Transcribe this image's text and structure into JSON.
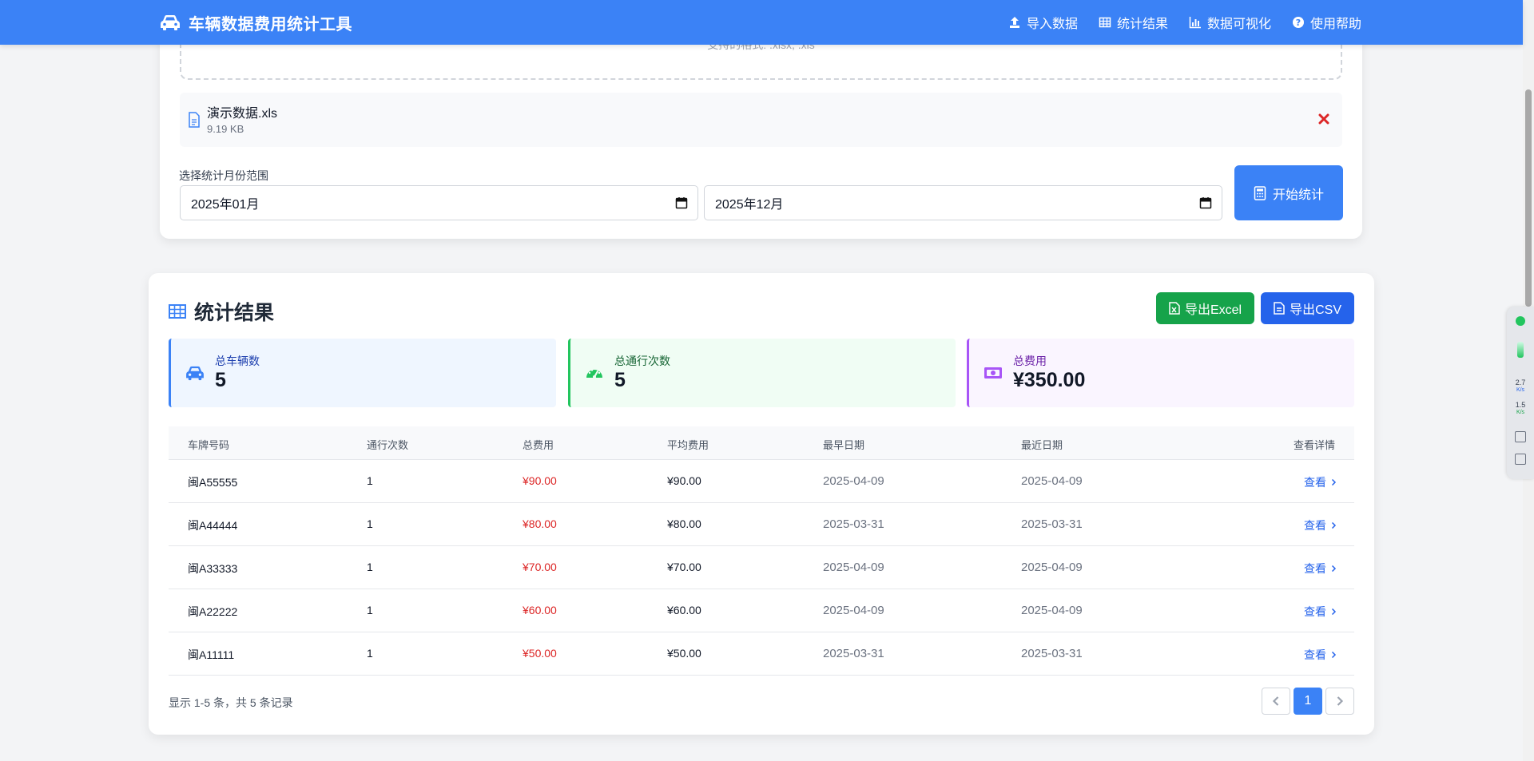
{
  "header": {
    "brand_title": "车辆数据费用统计工具",
    "nav": [
      {
        "label": "导入数据",
        "icon": "upload-icon"
      },
      {
        "label": "统计结果",
        "icon": "table-icon"
      },
      {
        "label": "数据可视化",
        "icon": "bar-chart-icon"
      },
      {
        "label": "使用帮助",
        "icon": "help-icon"
      }
    ]
  },
  "upload": {
    "format_hint": "支持的格式: .xlsx, .xls",
    "file": {
      "name": "演示数据.xls",
      "size": "9.19 KB"
    },
    "range_label": "选择统计月份范围",
    "start_month": "2025年01月",
    "end_month": "2025年12月",
    "start_button": "开始统计"
  },
  "results": {
    "title": "统计结果",
    "export_excel": "导出Excel",
    "export_csv": "导出CSV",
    "stats": [
      {
        "label": "总车辆数",
        "value": "5",
        "icon": "car-icon",
        "accent": "#3b82f6",
        "bg": "#eff6ff",
        "label_color": "#1e40af"
      },
      {
        "label": "总通行次数",
        "value": "5",
        "icon": "speedometer-icon",
        "accent": "#22c55e",
        "bg": "#f0fdf4",
        "label_color": "#166534"
      },
      {
        "label": "总费用",
        "value": "¥350.00",
        "icon": "money-icon",
        "accent": "#a855f7",
        "bg": "#faf5ff",
        "label_color": "#6b21a8"
      }
    ],
    "columns": [
      "车牌号码",
      "通行次数",
      "总费用",
      "平均费用",
      "最早日期",
      "最近日期",
      "查看详情"
    ],
    "rows": [
      {
        "plate": "闽A55555",
        "count": "1",
        "total": "¥90.00",
        "avg": "¥90.00",
        "first": "2025-04-09",
        "last": "2025-04-09",
        "action": "查看"
      },
      {
        "plate": "闽A44444",
        "count": "1",
        "total": "¥80.00",
        "avg": "¥80.00",
        "first": "2025-03-31",
        "last": "2025-03-31",
        "action": "查看"
      },
      {
        "plate": "闽A33333",
        "count": "1",
        "total": "¥70.00",
        "avg": "¥70.00",
        "first": "2025-04-09",
        "last": "2025-04-09",
        "action": "查看"
      },
      {
        "plate": "闽A22222",
        "count": "1",
        "total": "¥60.00",
        "avg": "¥60.00",
        "first": "2025-04-09",
        "last": "2025-04-09",
        "action": "查看"
      },
      {
        "plate": "闽A11111",
        "count": "1",
        "total": "¥50.00",
        "avg": "¥50.00",
        "first": "2025-03-31",
        "last": "2025-03-31",
        "action": "查看"
      }
    ],
    "pager_info": "显示 1-5 条，共 5 条记录",
    "current_page": "1"
  },
  "side_widget": {
    "up_speed": "2.7",
    "up_unit": "K/s",
    "down_speed": "1.5",
    "down_unit": "K/s"
  }
}
